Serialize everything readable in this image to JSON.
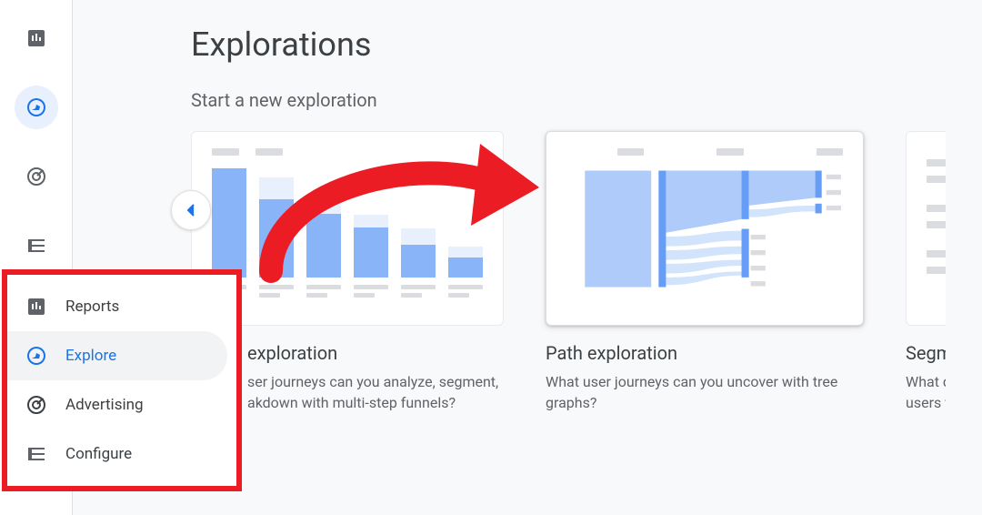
{
  "colors": {
    "accent": "#1a73e8",
    "annotation": "#ec1c24"
  },
  "page": {
    "title": "Explorations",
    "subtitle": "Start a new exploration"
  },
  "rail": [
    {
      "name": "reports",
      "icon": "reports-icon",
      "active": false
    },
    {
      "name": "explore",
      "icon": "explore-icon",
      "active": true
    },
    {
      "name": "advertising",
      "icon": "advertising-icon",
      "active": false
    },
    {
      "name": "configure",
      "icon": "configure-icon",
      "active": false
    }
  ],
  "nav_popup": {
    "items": [
      {
        "label": "Reports",
        "icon": "reports-icon",
        "selected": false
      },
      {
        "label": "Explore",
        "icon": "explore-icon",
        "selected": true
      },
      {
        "label": "Advertising",
        "icon": "advertising-icon",
        "selected": false
      },
      {
        "label": "Configure",
        "icon": "configure-icon",
        "selected": false
      }
    ]
  },
  "scroll_back_icon": "chevron-left-icon",
  "cards": [
    {
      "title": "Funnel exploration",
      "visible_title": "exploration",
      "desc_line1": "What user journeys can you analyze, segment,",
      "desc_line2": "and breakdown with multi-step funnels?",
      "visible_desc_line1": "ser journeys can you analyze, segment,",
      "visible_desc_line2": "akdown with multi-step funnels?",
      "preview_type": "funnel"
    },
    {
      "title": "Path exploration",
      "desc_line1": "What user journeys can you uncover with tree",
      "desc_line2": "graphs?",
      "preview_type": "path",
      "highlighted": true
    },
    {
      "title": "Segment overlap",
      "visible_title": "Segment o",
      "desc_line1": "What do intersections of",
      "desc_line2": "users tell you?",
      "visible_desc_line1": "What do int",
      "visible_desc_line2": "users tell yo",
      "preview_type": "segment"
    }
  ]
}
